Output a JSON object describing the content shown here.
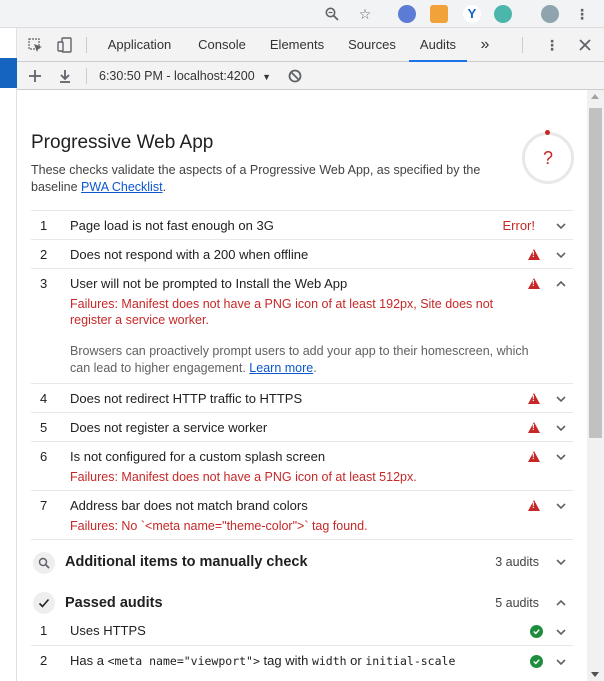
{
  "browser": {
    "icons": [
      "zoom-icon",
      "star-icon",
      "extension-icons",
      "profile-icon",
      "menu-icon"
    ]
  },
  "devtools": {
    "tabs": [
      {
        "label": "Application"
      },
      {
        "label": "Console"
      },
      {
        "label": "Elements"
      },
      {
        "label": "Sources"
      },
      {
        "label": "Audits"
      }
    ],
    "more": "»",
    "report_label": "6:30:50 PM - localhost:4200"
  },
  "pwa": {
    "title": "Progressive Web App",
    "description": "These checks validate the aspects of a Progressive Web App, as specified by the baseline ",
    "checklist_link": "PWA Checklist",
    "description_end": ".",
    "score_symbol": "?",
    "audits": [
      {
        "num": "1",
        "title": "Page load is not fast enough on 3G",
        "status": "Error!"
      },
      {
        "num": "2",
        "title": "Does not respond with a 200 when offline"
      },
      {
        "num": "3",
        "title": "User will not be prompted to Install the Web App",
        "failure": "Failures: Manifest does not have a PNG icon of at least 192px, Site does not register a service worker.",
        "help": "Browsers can proactively prompt users to add your app to their homescreen, which can lead to higher engagement. ",
        "help_link": "Learn more",
        "help_end": "."
      },
      {
        "num": "4",
        "title": "Does not redirect HTTP traffic to HTTPS"
      },
      {
        "num": "5",
        "title": "Does not register a service worker"
      },
      {
        "num": "6",
        "title": "Is not configured for a custom splash screen",
        "failure": "Failures: Manifest does not have a PNG icon of at least 512px."
      },
      {
        "num": "7",
        "title": "Address bar does not match brand colors",
        "failure": "Failures: No `<meta name=\"theme-color\">` tag found."
      }
    ],
    "manual": {
      "title": "Additional items to manually check",
      "count": "3 audits"
    },
    "passed": {
      "title": "Passed audits",
      "count": "5 audits",
      "items": [
        {
          "num": "1",
          "title": "Uses HTTPS"
        },
        {
          "num": "2",
          "title_pre": "Has a ",
          "code1": "<meta name=\"viewport\">",
          "title_mid": " tag with ",
          "code2": "width",
          "title_or": " or ",
          "code3": "initial-scale"
        }
      ]
    }
  },
  "colors": {
    "error": "#c62828",
    "pass": "#1e8e3e",
    "link": "#0b57d0",
    "active_tab": "#1a73e8"
  }
}
